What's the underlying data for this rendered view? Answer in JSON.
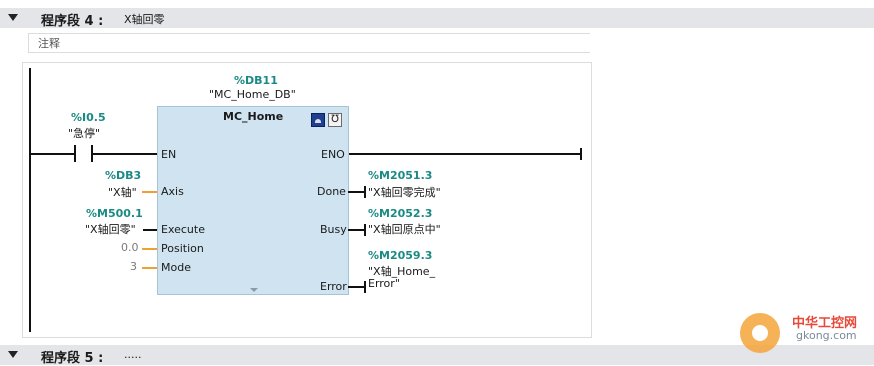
{
  "network4": {
    "title": "程序段 4 :",
    "subtitle": "X轴回零"
  },
  "comment_placeholder": "注释",
  "instance_db": {
    "address": "%DB11",
    "name": "\"MC_Home_DB\""
  },
  "function_block": {
    "name": "MC_Home"
  },
  "contact": {
    "address": "%I0.5",
    "name": "\"急停\""
  },
  "inputs": {
    "en": "EN",
    "axis": {
      "pin": "Axis",
      "address": "%DB3",
      "name": "\"X轴\""
    },
    "execute": {
      "pin": "Execute",
      "address": "%M500.1",
      "name": "\"X轴回零\""
    },
    "position": {
      "pin": "Position",
      "value": "0.0"
    },
    "mode": {
      "pin": "Mode",
      "value": "3"
    }
  },
  "outputs": {
    "eno": "ENO",
    "done": {
      "pin": "Done",
      "address": "%M2051.3",
      "name": "\"X轴回零完成\""
    },
    "busy": {
      "pin": "Busy",
      "address": "%M2052.3",
      "name": "\"X轴回原点中\""
    },
    "error": {
      "pin": "Error",
      "address": "%M2059.3",
      "name_line1": "\"X轴_Home_",
      "name_line2": "Error\""
    }
  },
  "network5": {
    "title": "程序段 5 :",
    "subtitle": "....."
  },
  "watermark": {
    "text": "中华工控网",
    "url": "gkong.com"
  },
  "colors": {
    "header_bg": "#e4e5e8",
    "fb_bg": "#cfe3f0",
    "address": "#1a8a84",
    "pin_wire": "#f0a030"
  }
}
